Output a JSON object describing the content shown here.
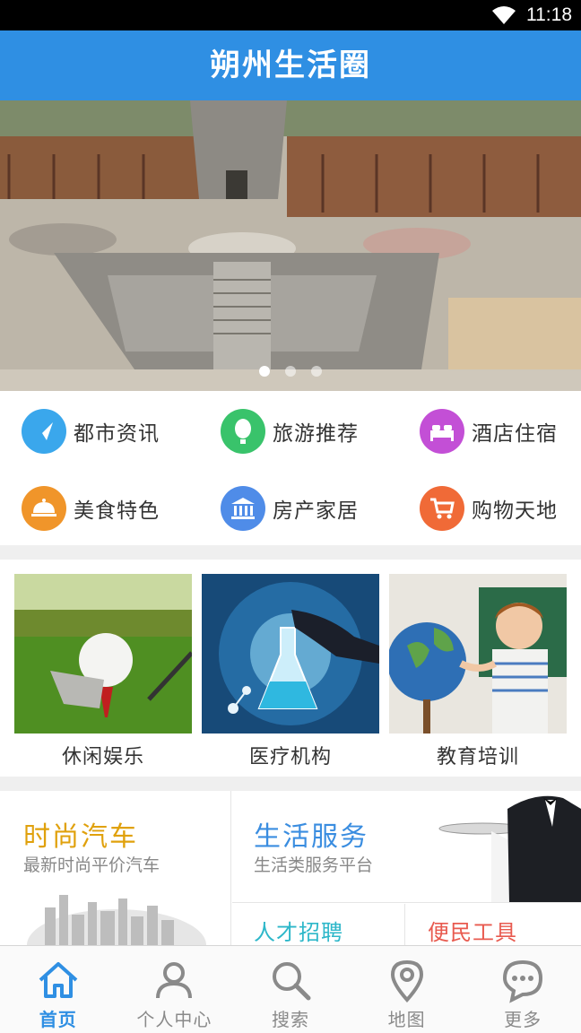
{
  "status_bar": {
    "time": "11:18",
    "wifi_icon": "wifi-icon"
  },
  "header": {
    "title": "朔州生活圈"
  },
  "banner": {
    "slide_count": 3,
    "active_slide": 1
  },
  "categories": [
    {
      "label": "都市资讯",
      "icon": "news-icon",
      "color": "#3aa7ec"
    },
    {
      "label": "旅游推荐",
      "icon": "balloon-icon",
      "color": "#39c36b"
    },
    {
      "label": "酒店住宿",
      "icon": "bed-icon",
      "color": "#c34fd6"
    },
    {
      "label": "美食特色",
      "icon": "food-cloche-icon",
      "color": "#f0952a"
    },
    {
      "label": "房产家居",
      "icon": "building-icon",
      "color": "#4f8ce8"
    },
    {
      "label": "购物天地",
      "icon": "cart-icon",
      "color": "#f06a37"
    }
  ],
  "cards": [
    {
      "label": "休闲娱乐",
      "image": "golf-ball-photo"
    },
    {
      "label": "医疗机构",
      "image": "lab-flask-photo"
    },
    {
      "label": "教育培训",
      "image": "boy-globe-photo"
    }
  ],
  "features": {
    "car": {
      "title": "时尚汽车",
      "subtitle": "最新时尚平价汽车"
    },
    "life": {
      "title": "生活服务",
      "subtitle": "生活类服务平台"
    },
    "job": {
      "title": "人才招聘"
    },
    "tool": {
      "title": "便民工具"
    }
  },
  "tabs": [
    {
      "label": "首页",
      "icon": "home-icon",
      "active": true
    },
    {
      "label": "个人中心",
      "icon": "person-icon",
      "active": false
    },
    {
      "label": "搜索",
      "icon": "search-icon",
      "active": false
    },
    {
      "label": "地图",
      "icon": "map-pin-icon",
      "active": false
    },
    {
      "label": "更多",
      "icon": "more-icon",
      "active": false
    }
  ],
  "colors": {
    "primary": "#2f8fe3",
    "car_title": "#e0a10c",
    "life_title": "#3a8de0",
    "job_title": "#2db7c9",
    "tool_title": "#e85a4f"
  }
}
